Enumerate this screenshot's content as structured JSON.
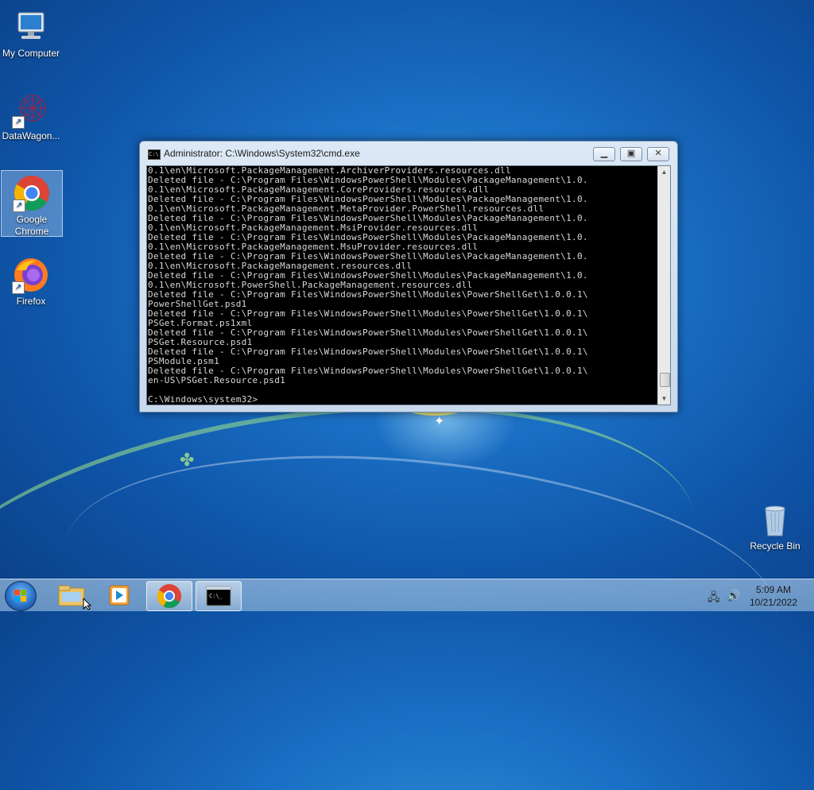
{
  "desktop": {
    "icons": [
      {
        "label": "My Computer"
      },
      {
        "label": "DataWagon..."
      },
      {
        "label": "Google Chrome"
      },
      {
        "label": "Firefox"
      },
      {
        "label": "Recycle Bin"
      }
    ]
  },
  "cmd": {
    "title": "Administrator: C:\\Windows\\System32\\cmd.exe",
    "lines": [
      "0.1\\en\\Microsoft.PackageManagement.ArchiverProviders.resources.dll",
      "Deleted file - C:\\Program Files\\WindowsPowerShell\\Modules\\PackageManagement\\1.0.",
      "0.1\\en\\Microsoft.PackageManagement.CoreProviders.resources.dll",
      "Deleted file - C:\\Program Files\\WindowsPowerShell\\Modules\\PackageManagement\\1.0.",
      "0.1\\en\\Microsoft.PackageManagement.MetaProvider.PowerShell.resources.dll",
      "Deleted file - C:\\Program Files\\WindowsPowerShell\\Modules\\PackageManagement\\1.0.",
      "0.1\\en\\Microsoft.PackageManagement.MsiProvider.resources.dll",
      "Deleted file - C:\\Program Files\\WindowsPowerShell\\Modules\\PackageManagement\\1.0.",
      "0.1\\en\\Microsoft.PackageManagement.MsuProvider.resources.dll",
      "Deleted file - C:\\Program Files\\WindowsPowerShell\\Modules\\PackageManagement\\1.0.",
      "0.1\\en\\Microsoft.PackageManagement.resources.dll",
      "Deleted file - C:\\Program Files\\WindowsPowerShell\\Modules\\PackageManagement\\1.0.",
      "0.1\\en\\Microsoft.PowerShell.PackageManagement.resources.dll",
      "Deleted file - C:\\Program Files\\WindowsPowerShell\\Modules\\PowerShellGet\\1.0.0.1\\",
      "PowerShellGet.psd1",
      "Deleted file - C:\\Program Files\\WindowsPowerShell\\Modules\\PowerShellGet\\1.0.0.1\\",
      "PSGet.Format.ps1xml",
      "Deleted file - C:\\Program Files\\WindowsPowerShell\\Modules\\PowerShellGet\\1.0.0.1\\",
      "PSGet.Resource.psd1",
      "Deleted file - C:\\Program Files\\WindowsPowerShell\\Modules\\PowerShellGet\\1.0.0.1\\",
      "PSModule.psm1",
      "Deleted file - C:\\Program Files\\WindowsPowerShell\\Modules\\PowerShellGet\\1.0.0.1\\",
      "en-US\\PSGet.Resource.psd1",
      "",
      "C:\\Windows\\system32>"
    ]
  },
  "taskbar": {
    "time": "5:09 AM",
    "date": "10/21/2022"
  },
  "colors": {
    "console_bg": "#000000",
    "console_fg": "#d8d8d8",
    "desktop_blue": "#1a6fc4"
  }
}
